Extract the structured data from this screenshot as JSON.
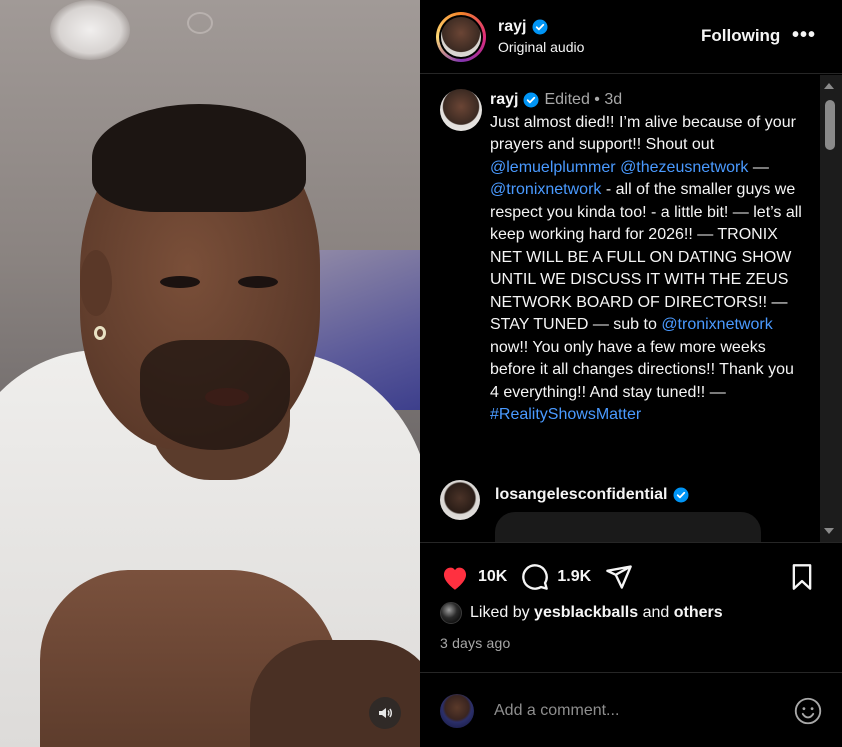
{
  "header": {
    "username": "rayj",
    "subtext": "Original audio",
    "follow_label": "Following",
    "more_label": "•••"
  },
  "caption": {
    "username": "rayj",
    "meta": "Edited • 3d",
    "parts": [
      {
        "text": "Just almost died!! I’m alive because of your prayers and support!! Shout out ",
        "link": false
      },
      {
        "text": "@lemuelplummer",
        "link": true
      },
      {
        "text": " ",
        "link": false
      },
      {
        "text": "@thezeusnetwork",
        "link": true
      },
      {
        "text": " — ",
        "link": false
      },
      {
        "text": "@tronixnetwork",
        "link": true
      },
      {
        "text": " - all of the smaller guys we respect you kinda too! - a little bit! — let’s all keep working hard for 2026!! — TRONIX NET WILL BE A FULL ON DATING SHOW UNTIL WE DISCUSS IT WITH THE ZEUS NETWORK BOARD OF DIRECTORS!! — STAY TUNED — sub to ",
        "link": false
      },
      {
        "text": "@tronixnetwork",
        "link": true
      },
      {
        "text": " now!! You only have a few more weeks before it all changes directions!! Thank you 4 everything!! And stay tuned!! — ",
        "link": false
      },
      {
        "text": "#RealityShowsMatter",
        "link": true
      }
    ]
  },
  "comment": {
    "username": "losangelesconfidential"
  },
  "actions": {
    "likes_count": "10K",
    "comments_count": "1.9K",
    "like_color": "#ff3040"
  },
  "likes": {
    "prefix": "Liked by",
    "user": "yesblackballs",
    "and": "and",
    "others": "others"
  },
  "time": "3 days ago",
  "comment_box": {
    "placeholder": "Add a comment..."
  },
  "icons": {
    "verified": "verified-badge-icon",
    "like": "heart-icon",
    "comment": "comment-bubble-icon",
    "share": "paper-plane-icon",
    "save": "bookmark-icon",
    "emoji": "smiley-icon",
    "mute": "speaker-icon"
  },
  "colors": {
    "link": "#4a9aff",
    "verified": "#0095f6",
    "background": "#000000"
  }
}
